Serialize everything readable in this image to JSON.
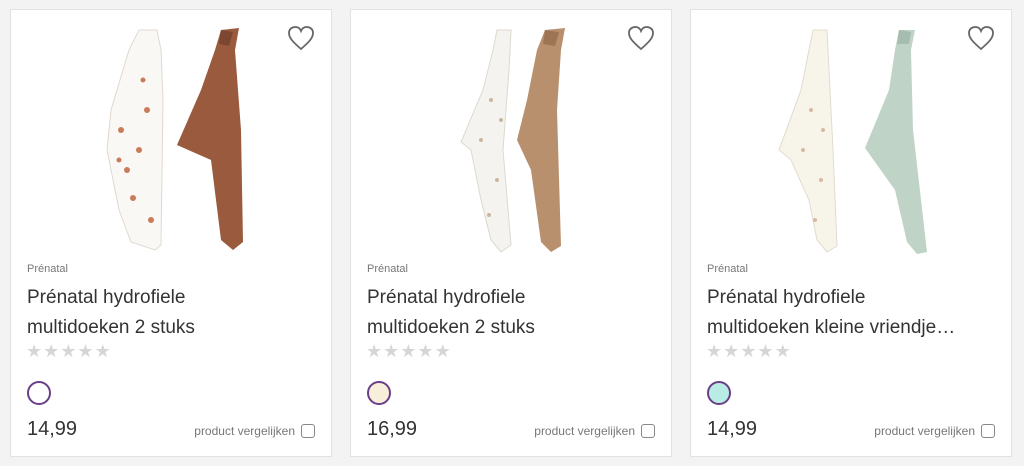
{
  "products": [
    {
      "brand": "Prénatal",
      "title_line1": "Prénatal hydrofiele",
      "title_line2": "multidoeken 2 stuks",
      "price": "14,99",
      "compare_label": "product vergelijken",
      "swatch_color": "#ffffff",
      "rating_stars": 0,
      "cloth_colors": [
        "#faf8f5",
        "#9a5a3e"
      ]
    },
    {
      "brand": "Prénatal",
      "title_line1": "Prénatal hydrofiele",
      "title_line2": "multidoeken 2 stuks",
      "price": "16,99",
      "compare_label": "product vergelijken",
      "swatch_color": "#f7efd9",
      "rating_stars": 0,
      "cloth_colors": [
        "#f4f3ef",
        "#b8906e"
      ]
    },
    {
      "brand": "Prénatal",
      "title_line1": "Prénatal hydrofiele",
      "title_line2": "multidoeken kleine vriendje…",
      "price": "14,99",
      "compare_label": "product vergelijken",
      "swatch_color": "#b9ece4",
      "rating_stars": 0,
      "cloth_colors": [
        "#f7f4ea",
        "#bfd3c6"
      ]
    }
  ],
  "colors": {
    "accent": "#6b3f87",
    "star_empty": "#d6d6d6"
  }
}
